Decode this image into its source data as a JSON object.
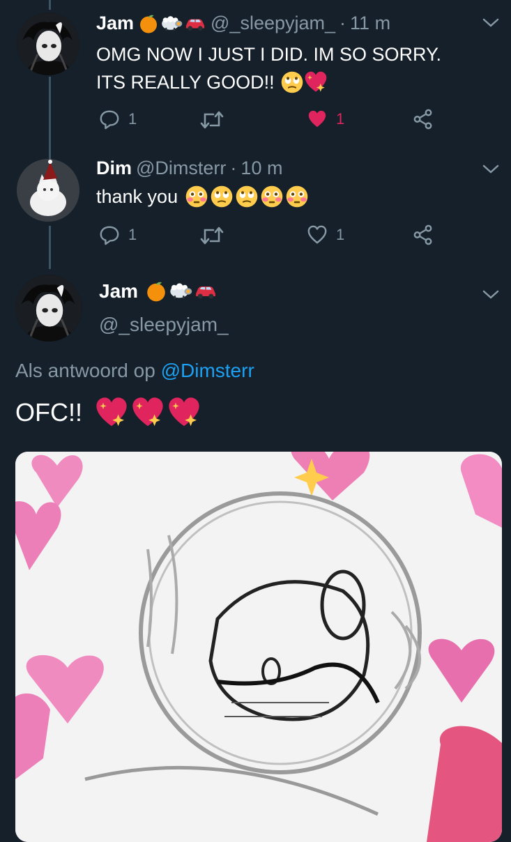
{
  "tweets": [
    {
      "name": "Jam",
      "handle": "@_sleepyjam_",
      "dot": "·",
      "time": "11 m",
      "line1": "OMG NOW I JUST I DID. IM SO SORRY.",
      "line2": "ITS REALLY GOOD!!",
      "reply_count": "1",
      "like_count": "1",
      "liked": true
    },
    {
      "name": "Dim",
      "handle": "@Dimsterr",
      "dot": "·",
      "time": "10 m",
      "line1": "thank you",
      "reply_count": "1",
      "like_count": "1",
      "liked": false
    }
  ],
  "main_tweet": {
    "name": "Jam",
    "handle": "@_sleepyjam_",
    "reply_prefix": "Als antwoord op",
    "reply_mention": "@Dimsterr",
    "text": "OFC!!",
    "media": "meme-image-hearts-blushing-character"
  },
  "colors": {
    "background": "#15202b",
    "secondary_text": "#8899a6",
    "link": "#1da1f2",
    "like": "#e0245e",
    "thread_line": "#3d5466"
  },
  "icons": [
    "reply-icon",
    "retweet-icon",
    "heart-icon",
    "share-icon",
    "chevron-down-icon",
    "orange-emoji",
    "sheep-emoji",
    "car-emoji",
    "sparkling-heart-emoji",
    "flushed-face-emoji",
    "rolling-eyes-face-emoji"
  ]
}
